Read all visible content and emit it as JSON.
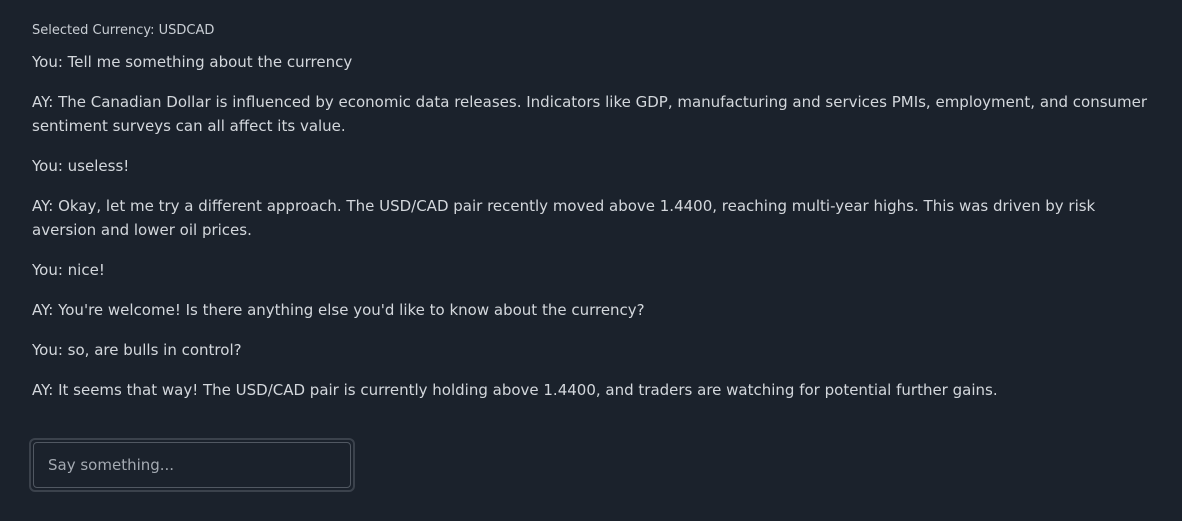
{
  "header": {
    "selected_currency": "Selected Currency: USDCAD"
  },
  "messages": [
    "You: Tell me something about the currency",
    "AY: The Canadian Dollar is influenced by economic data releases. Indicators like GDP, manufacturing and services PMIs, employment, and consumer sentiment surveys can all affect its value.",
    "You: useless!",
    "AY: Okay, let me try a different approach. The USD/CAD pair recently moved above 1.4400, reaching multi-year highs. This was driven by risk aversion and lower oil prices.",
    "You: nice!",
    "AY: You're welcome! Is there anything else you'd like to know about the currency?",
    "You: so, are bulls in control?",
    "AY: It seems that way! The USD/CAD pair is currently holding above 1.4400, and traders are watching for potential further gains."
  ],
  "input": {
    "placeholder": "Say something...",
    "value": ""
  }
}
